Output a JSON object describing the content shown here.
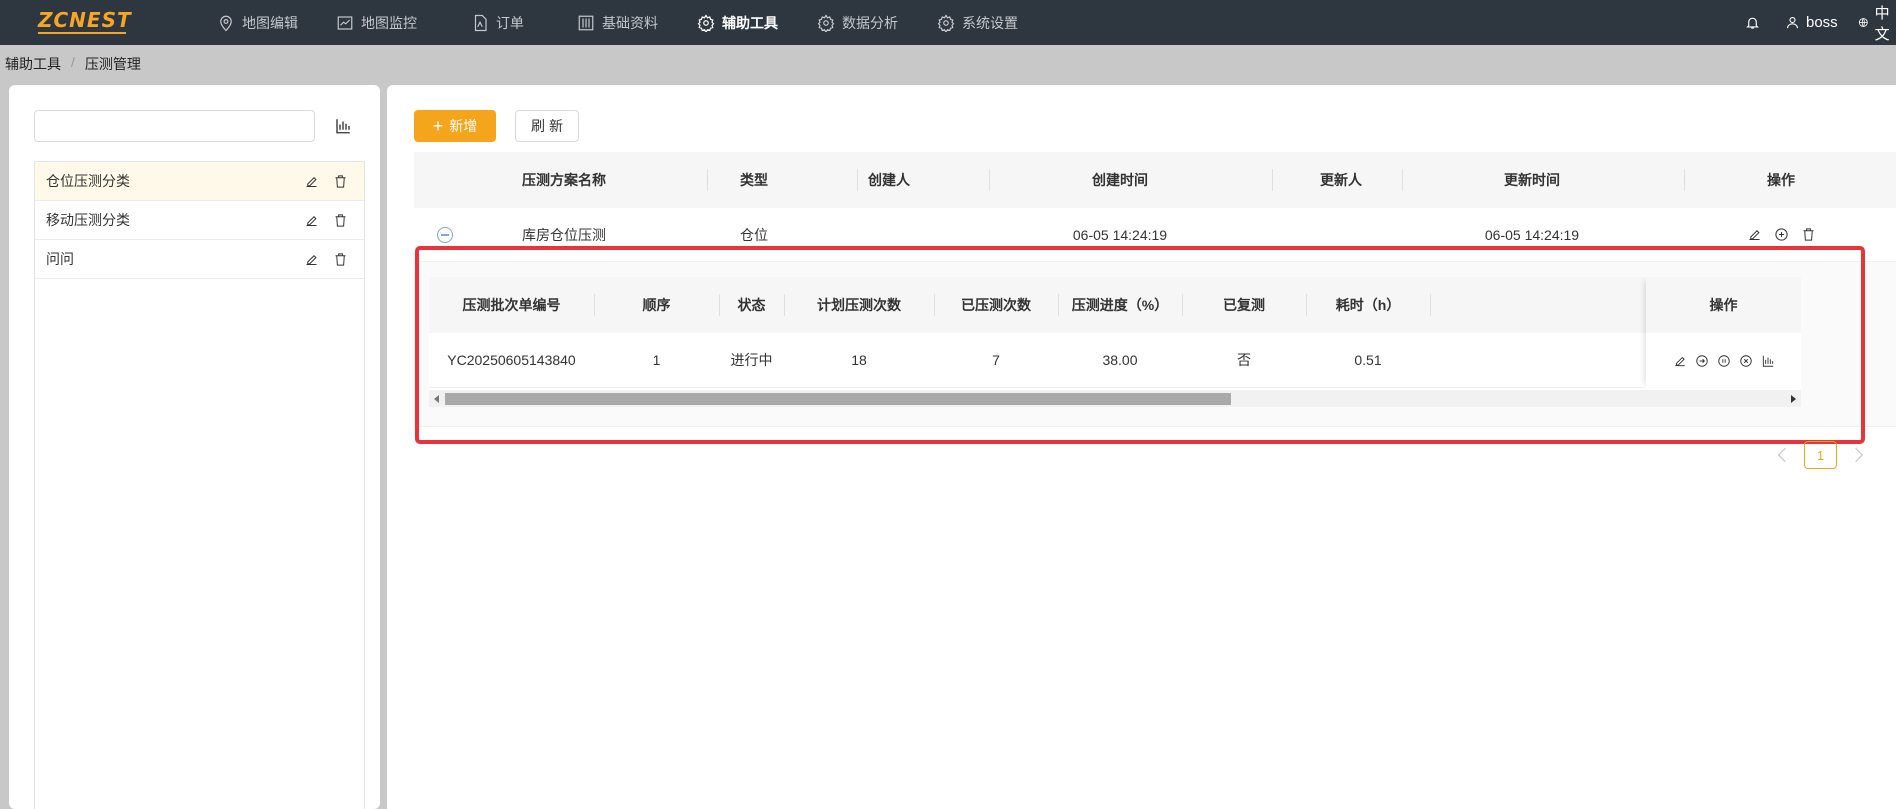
{
  "app": {
    "logo_text": "ZCNEST",
    "brand_color": "#f5a623",
    "accent_color": "#f5a51c",
    "highlight_color": "#e8333b"
  },
  "topnav": {
    "items": [
      {
        "label": "地图编辑",
        "icon": "map-pin-icon"
      },
      {
        "label": "地图监控",
        "icon": "line-chart-icon"
      },
      {
        "label": "订单",
        "icon": "document-icon"
      },
      {
        "label": "基础资料",
        "icon": "sliders-icon"
      },
      {
        "label": "辅助工具",
        "icon": "gear-icon",
        "active": true
      },
      {
        "label": "数据分析",
        "icon": "gear-icon"
      },
      {
        "label": "系统设置",
        "icon": "gear-icon"
      }
    ],
    "user": "boss",
    "language": "中文"
  },
  "breadcrumb": {
    "parent": "辅助工具",
    "separator": "/",
    "current": "压测管理"
  },
  "sidebar": {
    "search_value": "",
    "categories": [
      {
        "label": "仓位压测分类",
        "selected": true
      },
      {
        "label": "移动压测分类"
      },
      {
        "label": "问问"
      }
    ]
  },
  "toolbar": {
    "add_label": "新增",
    "refresh_label": "刷新"
  },
  "outer_table": {
    "columns": [
      "压测方案名称",
      "类型",
      "创建人",
      "创建时间",
      "更新人",
      "更新时间",
      "操作"
    ],
    "rows": [
      {
        "name": "库房仓位压测",
        "type": "仓位",
        "creator": "",
        "created_at": "06-05 14:24:19",
        "updater": "",
        "updated_at": "06-05 14:24:19"
      }
    ]
  },
  "inner_table": {
    "columns": [
      "压测批次单编号",
      "顺序",
      "状态",
      "计划压测次数",
      "已压测次数",
      "压测进度（%）",
      "已复测",
      "耗时（h）",
      "操作"
    ],
    "rows": [
      {
        "batch_no": "YC20250605143840",
        "order": "1",
        "status": "进行中",
        "planned": "18",
        "done": "7",
        "progress": "38.00",
        "retested": "否",
        "duration": "0.51"
      }
    ]
  },
  "pagination": {
    "current_page": "1"
  }
}
